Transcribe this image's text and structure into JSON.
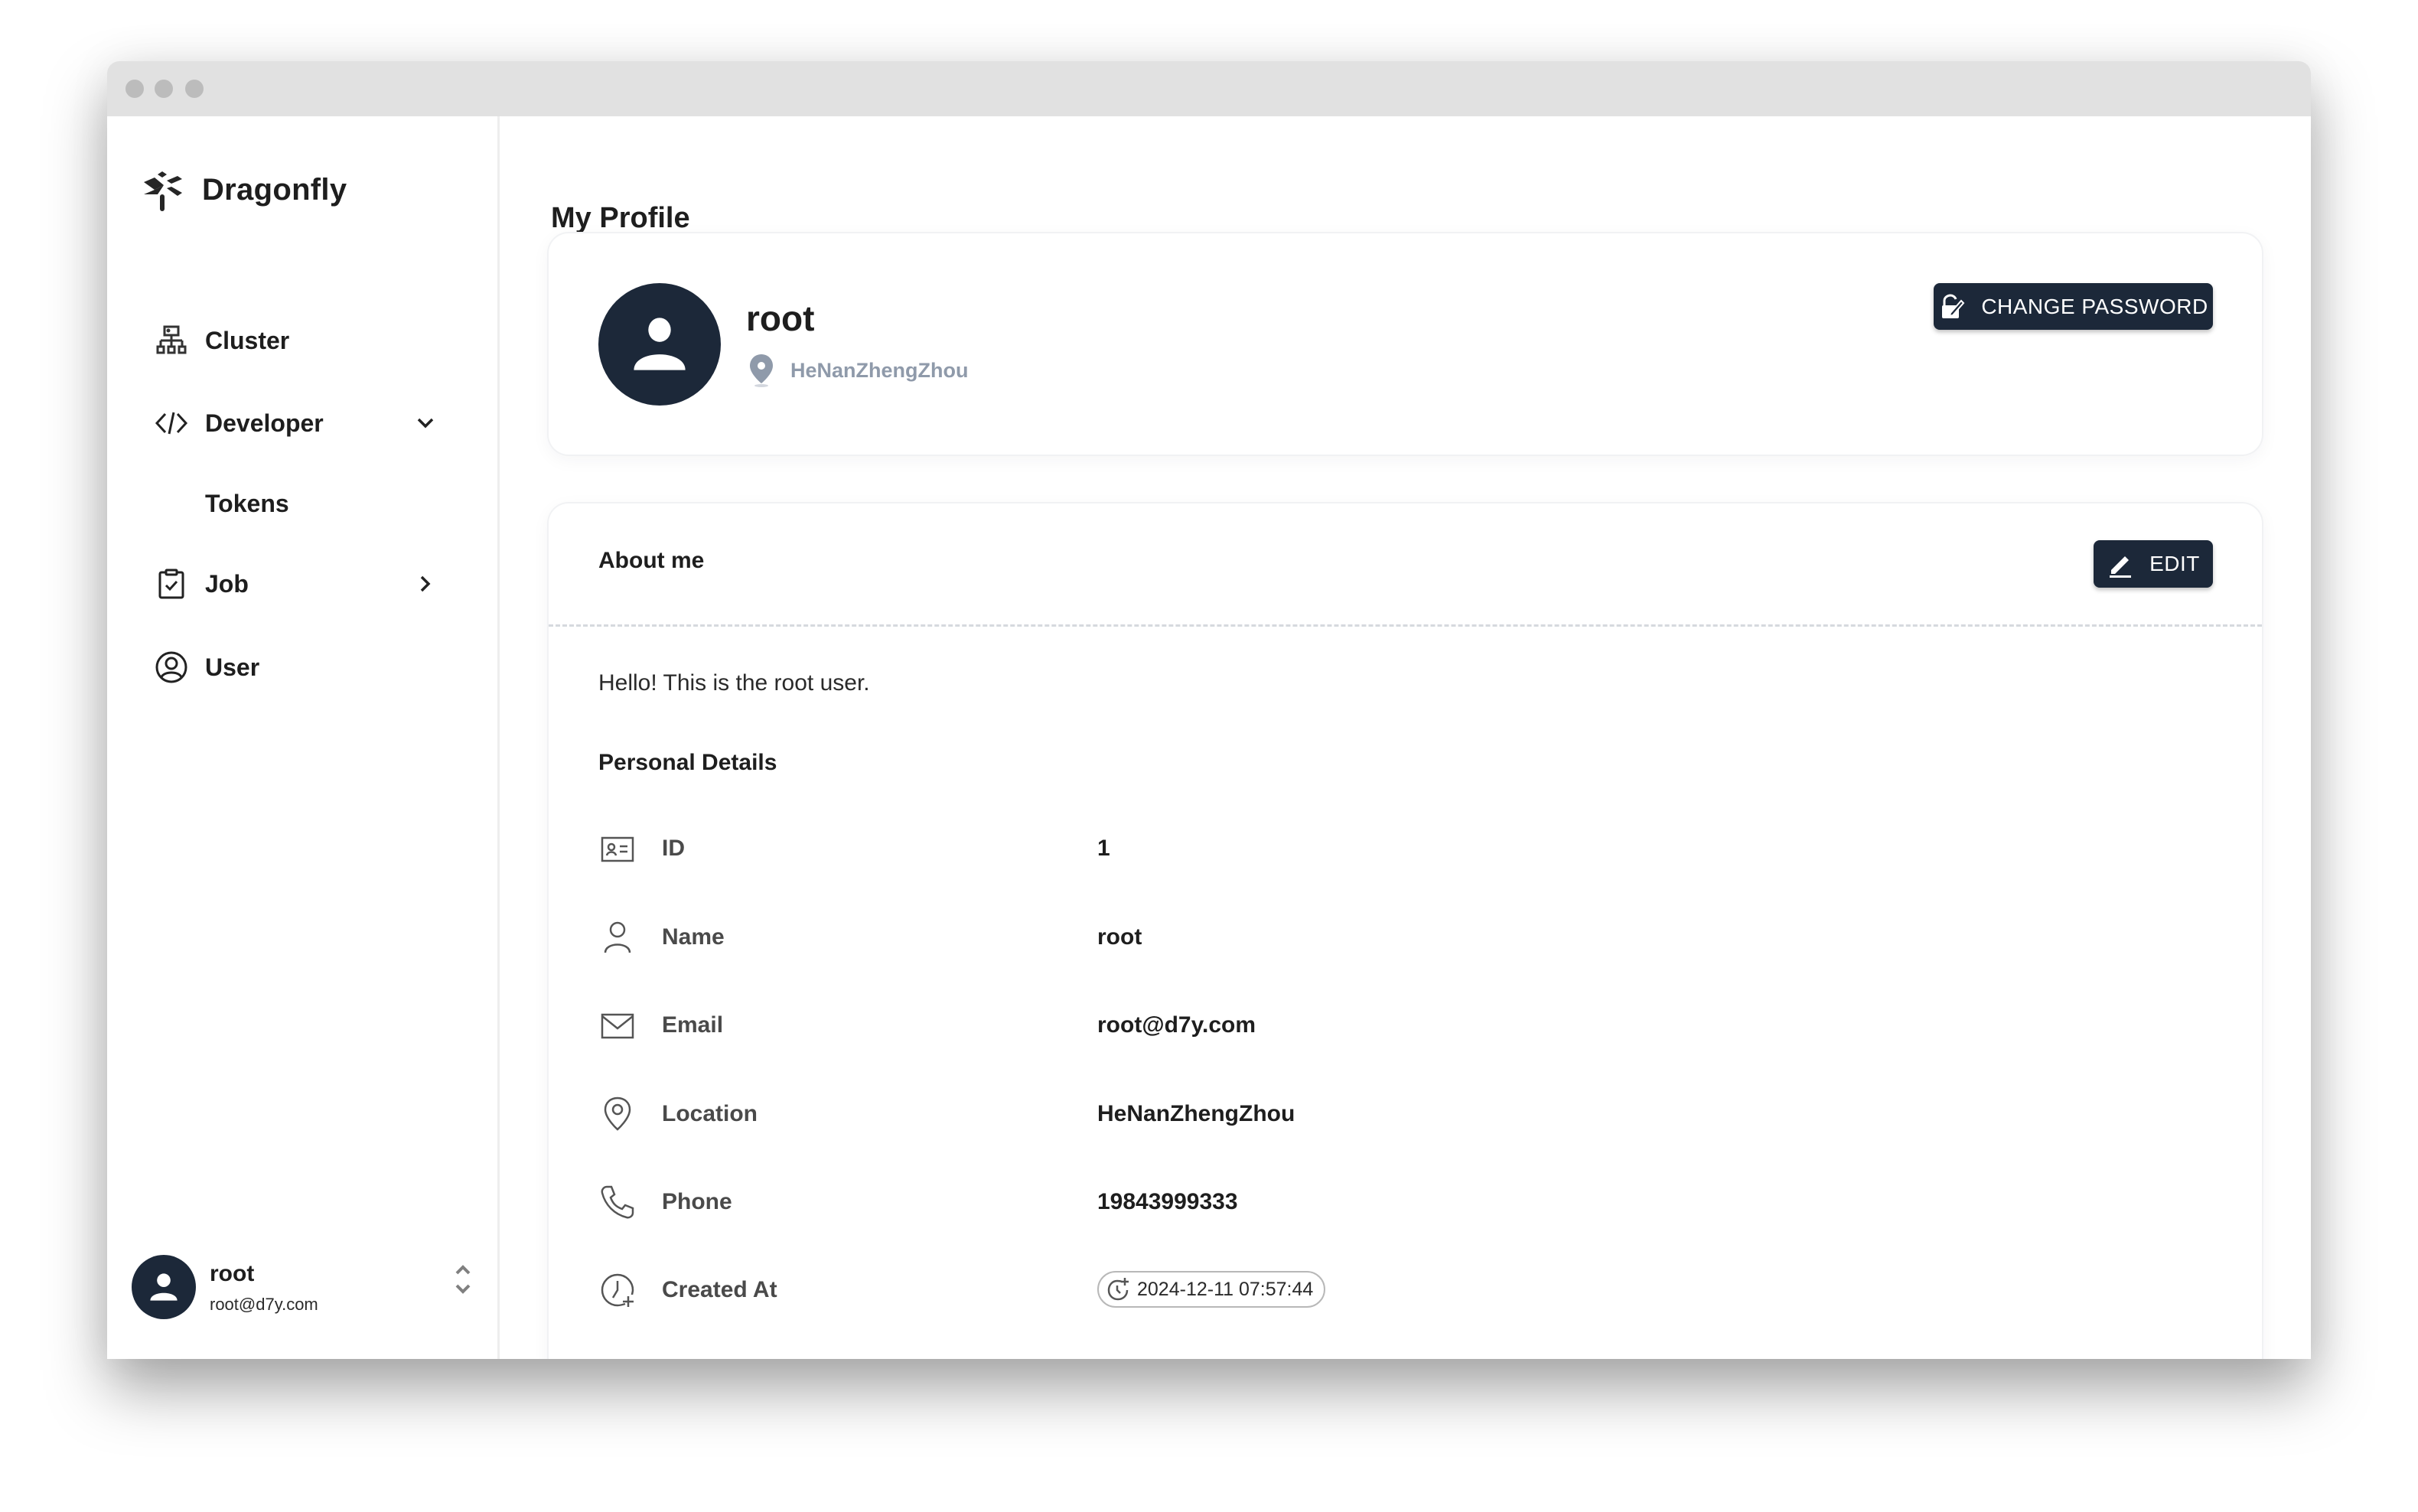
{
  "window": {
    "title_dots": [
      "close",
      "minimize",
      "maximize"
    ]
  },
  "sidebar": {
    "brand": "Dragonfly",
    "items": [
      {
        "label": "Cluster",
        "icon": "cluster-icon"
      },
      {
        "label": "Developer",
        "icon": "code-icon",
        "expanded": true
      },
      {
        "label": "Tokens",
        "sub": true
      },
      {
        "label": "Job",
        "icon": "clipboard-check-icon",
        "expanded": false
      },
      {
        "label": "User",
        "icon": "user-circle-icon"
      }
    ],
    "user": {
      "name": "root",
      "email": "root@d7y.com"
    }
  },
  "main": {
    "page_title": "My Profile",
    "profile": {
      "name": "root",
      "location": "HeNanZhengZhou",
      "change_password_label": "CHANGE PASSWORD"
    },
    "about": {
      "title": "About me",
      "edit_label": "EDIT",
      "text": "Hello! This is the root user.",
      "details_title": "Personal Details",
      "details": [
        {
          "label": "ID",
          "value": "1",
          "icon": "id-card-icon"
        },
        {
          "label": "Name",
          "value": "root",
          "icon": "person-icon"
        },
        {
          "label": "Email",
          "value": "root@d7y.com",
          "icon": "mail-icon"
        },
        {
          "label": "Location",
          "value": "HeNanZhengZhou",
          "icon": "location-icon"
        },
        {
          "label": "Phone",
          "value": "19843999333",
          "icon": "phone-icon"
        },
        {
          "label": "Created At",
          "value": "2024-12-11 07:57:44",
          "icon": "clock-plus-icon"
        }
      ]
    }
  },
  "colors": {
    "primary_dark": "#1c2839",
    "muted_text": "#8f9aaa",
    "titlebar": "#e1e1e1"
  }
}
